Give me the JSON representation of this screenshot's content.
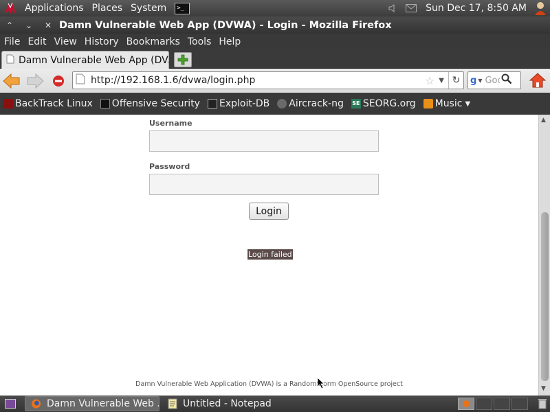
{
  "top_panel": {
    "menus": [
      "Applications",
      "Places",
      "System"
    ],
    "clock": "Sun Dec 17,  8:50 AM"
  },
  "window": {
    "title": "Damn Vulnerable Web App (DVWA) - Login - Mozilla Firefox"
  },
  "menubar": {
    "items": [
      "File",
      "Edit",
      "View",
      "History",
      "Bookmarks",
      "Tools",
      "Help"
    ]
  },
  "tabs": [
    {
      "label": "Damn Vulnerable Web App (DV..."
    }
  ],
  "navbar": {
    "url": "http://192.168.1.6/dvwa/login.php",
    "search_placeholder": "Google"
  },
  "bookmarks": [
    {
      "label": "BackTrack Linux",
      "icon": "backtrack-icon"
    },
    {
      "label": "Offensive Security",
      "icon": "offsec-icon"
    },
    {
      "label": "Exploit-DB",
      "icon": "exploitdb-icon"
    },
    {
      "label": "Aircrack-ng",
      "icon": "aircrack-icon"
    },
    {
      "label": "SEORG.org",
      "icon": "seorg-icon"
    },
    {
      "label": "Music",
      "icon": "folder-icon"
    }
  ],
  "login_form": {
    "username_label": "Username",
    "username_value": "",
    "password_label": "Password",
    "password_value": "",
    "submit_label": "Login"
  },
  "message": "Login failed",
  "footer": "Damn Vulnerable Web Application (DVWA) is a RandomStorm OpenSource project",
  "taskbar": {
    "tasks": [
      "Damn Vulnerable Web ...",
      "Untitled - Notepad"
    ]
  },
  "colors": {
    "panel": "#3c3c3c",
    "message_bg": "#5a4a4a",
    "accent_orange": "#f29019"
  }
}
